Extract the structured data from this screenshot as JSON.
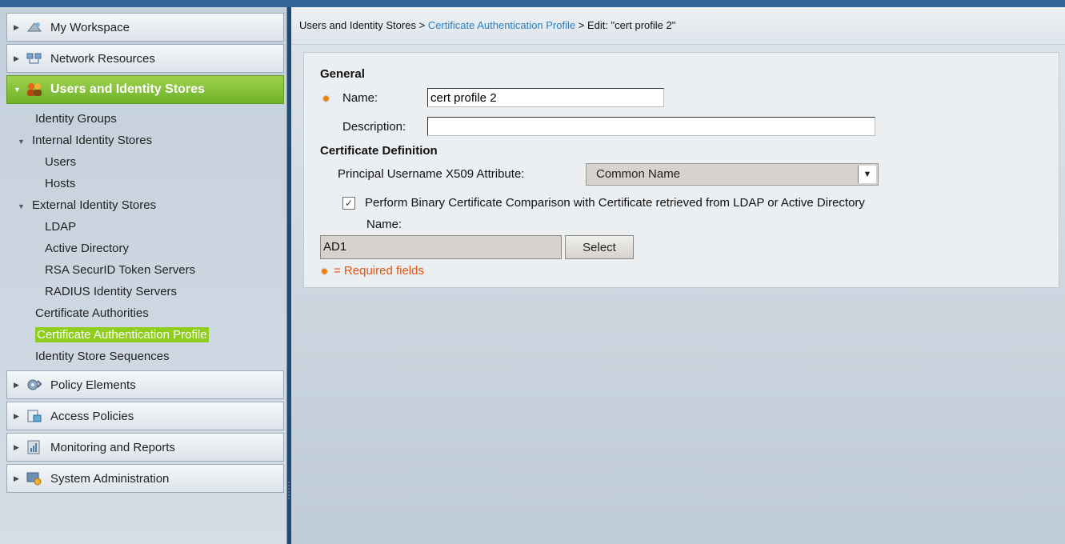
{
  "sidebar": {
    "headers": [
      {
        "label": "My Workspace",
        "icon": "workspace-icon"
      },
      {
        "label": "Network Resources",
        "icon": "network-resources-icon"
      },
      {
        "label": "Users and Identity Stores",
        "icon": "users-icon"
      },
      {
        "label": "Policy Elements",
        "icon": "policy-elements-icon"
      },
      {
        "label": "Access Policies",
        "icon": "access-policies-icon"
      },
      {
        "label": "Monitoring and Reports",
        "icon": "monitoring-icon"
      },
      {
        "label": "System Administration",
        "icon": "system-admin-icon"
      }
    ],
    "sub_items": [
      "Identity Groups",
      "Internal Identity Stores",
      "Users",
      "Hosts",
      "External Identity Stores",
      "LDAP",
      "Active Directory",
      "RSA SecurID Token Servers",
      "RADIUS Identity Servers",
      "Certificate Authorities",
      "Certificate Authentication Profile",
      "Identity Store Sequences"
    ],
    "active_header": "Users and Identity Stores",
    "selected_item": "Certificate Authentication Profile"
  },
  "breadcrumb": {
    "part1": "Users and Identity Stores",
    "sep": ">",
    "part2": "Certificate Authentication Profile",
    "part3": "Edit: \"cert profile 2\""
  },
  "form": {
    "general_title": "General",
    "name_label": "Name:",
    "name_value": "cert profile 2",
    "description_label": "Description:",
    "description_value": "",
    "cert_def_title": "Certificate Definition",
    "principal_label": "Principal Username X509 Attribute:",
    "principal_value": "Common Name",
    "binary_compare_label": "Perform Binary Certificate Comparison with Certificate retrieved from LDAP or Active Directory",
    "binary_compare_checked": true,
    "store_name_label": "Name:",
    "store_name_value": "AD1",
    "select_button": "Select",
    "required_note": "= Required fields"
  },
  "colors": {
    "active_header": "#7cbc2e",
    "link": "#2a7fc0",
    "required": "#e2540e",
    "required_icon": "#e8800c"
  }
}
